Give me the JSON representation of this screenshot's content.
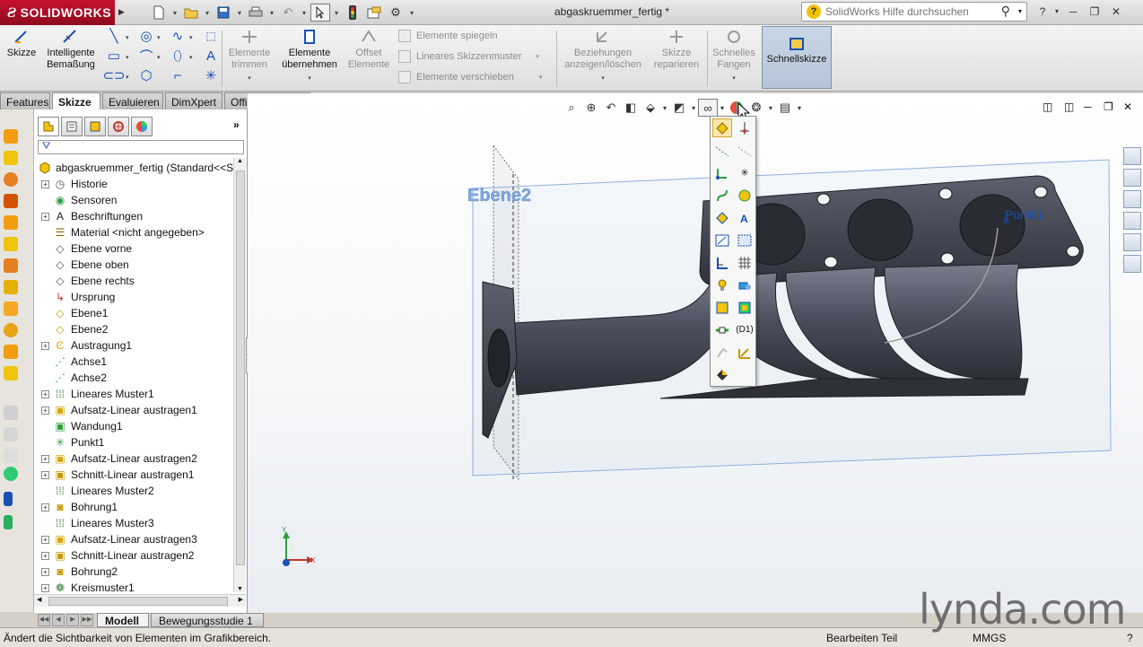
{
  "app": {
    "brand": "SOLIDWORKS",
    "document_title": "abgaskruemmer_fertig *",
    "help_search": {
      "placeholder": "SolidWorks Hilfe durchsuchen"
    }
  },
  "ribbon": {
    "skizze": "Skizze",
    "bemassung": "Intelligente Bemaßung",
    "trimmen": "Elemente trimmen",
    "uebernehmen": "Elemente übernehmen",
    "offset": "Offset Elemente",
    "spiegeln": "Elemente spiegeln",
    "lineares_muster": "Lineares Skizzenmuster",
    "verschieben": "Elemente verschieben",
    "beziehungen": "Beziehungen anzeigen/löschen",
    "reparieren": "Skizze reparieren",
    "fangen": "Schnelles Fangen",
    "schnellskizze": "Schnellskizze"
  },
  "tabs": [
    "Features",
    "Skizze",
    "Evaluieren",
    "DimXpert",
    "Office Produkte"
  ],
  "active_tab": "Skizze",
  "tree": {
    "root": "abgaskruemmer_fertig  (Standard<<S",
    "items": [
      {
        "label": "Historie",
        "icon": "history-icon",
        "expandable": true
      },
      {
        "label": "Sensoren",
        "icon": "sensor-icon",
        "expandable": false
      },
      {
        "label": "Beschriftungen",
        "icon": "annotation-icon",
        "expandable": true
      },
      {
        "label": "Material <nicht angegeben>",
        "icon": "material-icon",
        "expandable": false
      },
      {
        "label": "Ebene vorne",
        "icon": "plane-icon",
        "expandable": false
      },
      {
        "label": "Ebene oben",
        "icon": "plane-icon",
        "expandable": false
      },
      {
        "label": "Ebene rechts",
        "icon": "plane-icon",
        "expandable": false
      },
      {
        "label": "Ursprung",
        "icon": "origin-icon",
        "expandable": false
      },
      {
        "label": "Ebene1",
        "icon": "plane-icon",
        "expandable": false
      },
      {
        "label": "Ebene2",
        "icon": "plane-icon",
        "expandable": false
      },
      {
        "label": "Austragung1",
        "icon": "sweep-icon",
        "expandable": true
      },
      {
        "label": "Achse1",
        "icon": "axis-icon",
        "expandable": false
      },
      {
        "label": "Achse2",
        "icon": "axis-icon",
        "expandable": false
      },
      {
        "label": "Lineares Muster1",
        "icon": "linear-pattern-icon",
        "expandable": true
      },
      {
        "label": "Aufsatz-Linear austragen1",
        "icon": "extrude-icon",
        "expandable": true
      },
      {
        "label": "Wandung1",
        "icon": "shell-icon",
        "expandable": false
      },
      {
        "label": "Punkt1",
        "icon": "point-icon",
        "expandable": false
      },
      {
        "label": "Aufsatz-Linear austragen2",
        "icon": "extrude-icon",
        "expandable": true
      },
      {
        "label": "Schnitt-Linear austragen1",
        "icon": "cut-icon",
        "expandable": true
      },
      {
        "label": "Lineares Muster2",
        "icon": "linear-pattern-icon",
        "expandable": false
      },
      {
        "label": "Bohrung1",
        "icon": "hole-icon",
        "expandable": true
      },
      {
        "label": "Lineares Muster3",
        "icon": "linear-pattern-icon",
        "expandable": false
      },
      {
        "label": "Aufsatz-Linear austragen3",
        "icon": "extrude-icon",
        "expandable": true
      },
      {
        "label": "Schnitt-Linear austragen2",
        "icon": "cut-icon",
        "expandable": true
      },
      {
        "label": "Bohrung2",
        "icon": "hole-icon",
        "expandable": true
      },
      {
        "label": "Kreismuster1",
        "icon": "circular-pattern-icon",
        "expandable": true
      }
    ]
  },
  "viewport": {
    "plane_label": "Ebene2",
    "point_label": "Punkt1",
    "palette_label": "(D1)"
  },
  "model_tabs": [
    "Modell",
    "Bewegungsstudie 1"
  ],
  "status": {
    "message": "Ändert die Sichtbarkeit von Elementen im Grafikbereich.",
    "mode": "Bearbeiten Teil",
    "units": "MMGS",
    "help": "?"
  },
  "watermark": "lynda.com",
  "colors": {
    "brand_red": "#c8102e",
    "sketch_blue": "#1a4fb5",
    "plane_blue": "#6f9bd8"
  }
}
